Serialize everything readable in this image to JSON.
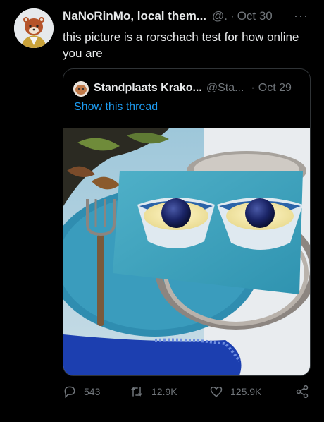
{
  "tweet": {
    "author_name": "NaNoRinMo, local them...",
    "handle": "@.",
    "separator": "·",
    "date": "Oct 30",
    "more_label": "···",
    "text": "this picture is a rorschach test for how online you are"
  },
  "quoted": {
    "author_name": "Standplaats Krako...",
    "handle": "@Sta...",
    "separator": "·",
    "date": "Oct 29",
    "show_thread": "Show this thread"
  },
  "actions": {
    "replies": "543",
    "retweets": "12.9K",
    "likes": "125.9K"
  },
  "colors": {
    "background": "#000000",
    "text": "#e7e9ea",
    "muted": "#71767b",
    "link": "#1d9bf0",
    "border": "#2f3336"
  },
  "icons": [
    "reply-icon",
    "retweet-icon",
    "like-icon",
    "share-icon",
    "more-icon"
  ]
}
